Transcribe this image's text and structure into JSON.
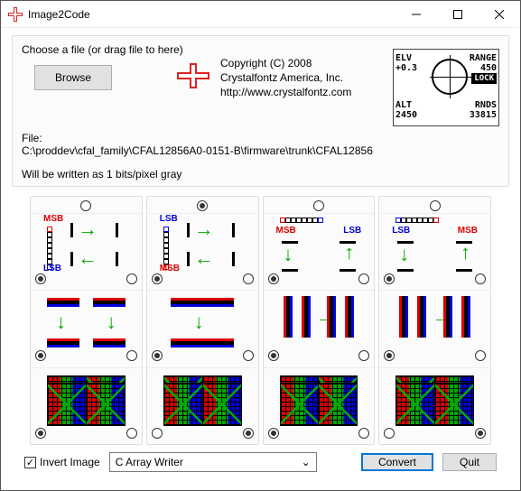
{
  "window": {
    "title": "Image2Code"
  },
  "top": {
    "instruction": "Choose a file (or drag file to here)",
    "browse": "Browse",
    "copyright_line1": "Copyright (C) 2008",
    "copyright_line2": "Crystalfontz America, Inc.",
    "copyright_url": "http://www.crystalfontz.com",
    "file_label": "File:",
    "file_path": "C:\\proddev\\cfal_family\\CFAL12856A0-0151-B\\firmware\\trunk\\CFAL12856",
    "written_as": "Will be written as 1 bits/pixel gray"
  },
  "preview": {
    "elv_label": "ELV",
    "elv_value": "+0.3",
    "alt_label": "ALT",
    "alt_value": "2450",
    "range_label": "RANGE",
    "range_value": "450",
    "lock_label": "LOCK",
    "rnds_label": "RNDS",
    "rnds_value": "33815"
  },
  "labels": {
    "msb": "MSB",
    "lsb": "LSB"
  },
  "panels": {
    "selected_index": 1
  },
  "bottom": {
    "invert_label": "Invert Image",
    "invert_checked": true,
    "writer_selected": "C Array Writer",
    "convert": "Convert",
    "quit": "Quit"
  }
}
